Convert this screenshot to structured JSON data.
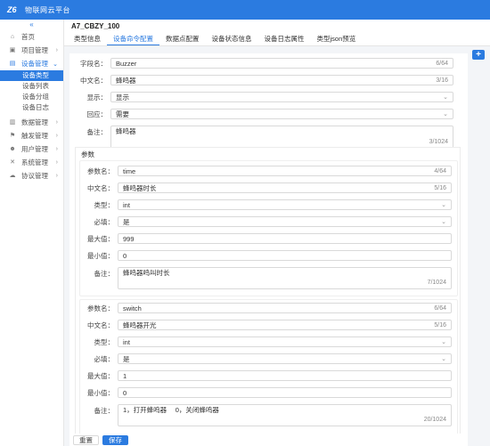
{
  "app": {
    "title": "物联网云平台",
    "logo_text": "Z6"
  },
  "sidebar": {
    "collapse_icon": "«",
    "items": [
      {
        "label": "首页",
        "icon": "home-icon",
        "glyph": "⌂"
      },
      {
        "label": "项目管理",
        "icon": "project-icon",
        "glyph": "▣"
      },
      {
        "label": "设备管理",
        "icon": "device-icon",
        "glyph": "▤"
      },
      {
        "label": "数据管理",
        "icon": "data-icon",
        "glyph": "▥"
      },
      {
        "label": "触发管理",
        "icon": "trigger-icon",
        "glyph": "⚑"
      },
      {
        "label": "用户管理",
        "icon": "user-icon",
        "glyph": "☻"
      },
      {
        "label": "系统管理",
        "icon": "system-icon",
        "glyph": "✕"
      },
      {
        "label": "协议管理",
        "icon": "protocol-icon",
        "glyph": "☁"
      }
    ],
    "sub_items": [
      "设备类型",
      "设备列表",
      "设备分组",
      "设备日志"
    ]
  },
  "page": {
    "title": "A7_CBZY_100",
    "tabs": [
      "类型信息",
      "设备命令配置",
      "数据点配置",
      "设备状态信息",
      "设备日志属性",
      "类型json预览"
    ],
    "add_button": "+"
  },
  "form": {
    "field_name": {
      "label": "字段名：",
      "value": "Buzzer",
      "count": "6/64"
    },
    "cn_name": {
      "label": "中文名：",
      "value": "蜂鸣器",
      "count": "3/16"
    },
    "display": {
      "label": "显示：",
      "value": "显示"
    },
    "reply": {
      "label": "回应：",
      "value": "需要"
    },
    "remark": {
      "label": "备注：",
      "value": "蜂鸣器",
      "count": "3/1024"
    }
  },
  "params": {
    "title": "参数",
    "items": [
      {
        "name_label": "参数名：",
        "name": "time",
        "name_count": "4/64",
        "cn_label": "中文名：",
        "cn": "蜂鸣器时长",
        "cn_count": "5/16",
        "type_label": "类型：",
        "type": "int",
        "required_label": "必填：",
        "required": "是",
        "max_label": "最大值：",
        "max": "999",
        "min_label": "最小值：",
        "min": "0",
        "remark_label": "备注：",
        "remark": "蜂鸣器鸣叫时长",
        "remark_count": "7/1024"
      },
      {
        "name_label": "参数名：",
        "name": "switch",
        "name_count": "6/64",
        "cn_label": "中文名：",
        "cn": "蜂鸣器开光",
        "cn_count": "5/16",
        "type_label": "类型：",
        "type": "int",
        "required_label": "必填：",
        "required": "是",
        "max_label": "最大值：",
        "max": "1",
        "min_label": "最小值：",
        "min": "0",
        "remark_label": "备注：",
        "remark": "1，打开蜂鸣器　 0，关闭蜂鸣器",
        "remark_count": "20/1024"
      }
    ]
  },
  "footer": {
    "reset_label": "重置",
    "save_label": "保存"
  },
  "colors": {
    "accent": "#2b7be0",
    "background": "#f3f5f8"
  }
}
